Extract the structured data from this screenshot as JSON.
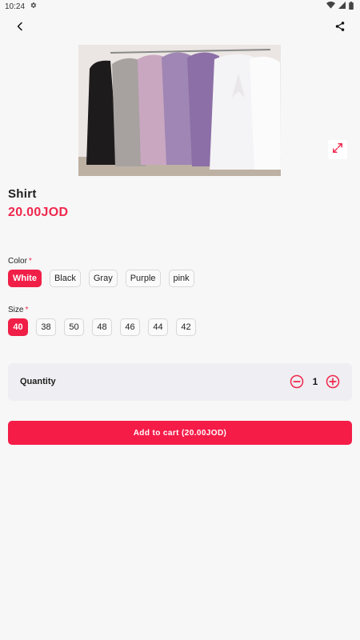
{
  "status_bar": {
    "time": "10:24"
  },
  "product": {
    "title": "Shirt",
    "price": "20.00JOD"
  },
  "color_option": {
    "label": "Color",
    "required_mark": "*",
    "options": [
      "White",
      "Black",
      "Gray",
      "Purple",
      "pink"
    ],
    "selected": "White"
  },
  "size_option": {
    "label": "Size",
    "required_mark": "*",
    "options": [
      "40",
      "38",
      "50",
      "48",
      "46",
      "44",
      "42"
    ],
    "selected": "40"
  },
  "quantity": {
    "label": "Quantity",
    "value": "1"
  },
  "cart": {
    "button_label": "Add to cart (20.00JOD)"
  },
  "icons": {
    "back": "back-arrow-icon",
    "share": "share-icon",
    "expand": "expand-icon",
    "minus": "minus-circle-icon",
    "plus": "plus-circle-icon"
  },
  "colors": {
    "accent": "#f01f47"
  }
}
